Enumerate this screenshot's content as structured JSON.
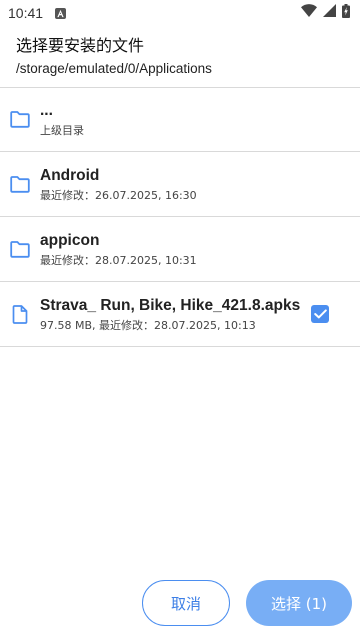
{
  "status_bar": {
    "time": "10:41"
  },
  "header": {
    "title": "选择要安装的文件",
    "path": "/storage/emulated/0/Applications"
  },
  "files": [
    {
      "type": "folder",
      "name": "...",
      "meta": "上级目录",
      "checked": false
    },
    {
      "type": "folder",
      "name": "Android",
      "meta": "最近修改：26.07.2025, 16:30",
      "checked": false
    },
    {
      "type": "folder",
      "name": "appicon",
      "meta": "最近修改：28.07.2025, 10:31",
      "checked": false
    },
    {
      "type": "file",
      "name": "Strava_ Run, Bike, Hike_421.8.apks",
      "meta": "97.58 MB, 最近修改：28.07.2025, 10:13",
      "checked": true
    }
  ],
  "buttons": {
    "cancel_label": "取消",
    "select_label": "选择 (1)"
  },
  "colors": {
    "accent": "#4b8ef0",
    "primary_button": "#78aef5",
    "divider": "#d9d9d9"
  },
  "icons": {
    "folder": "folder-icon",
    "file": "file-icon",
    "checkbox": "checkbox-checked-icon"
  }
}
